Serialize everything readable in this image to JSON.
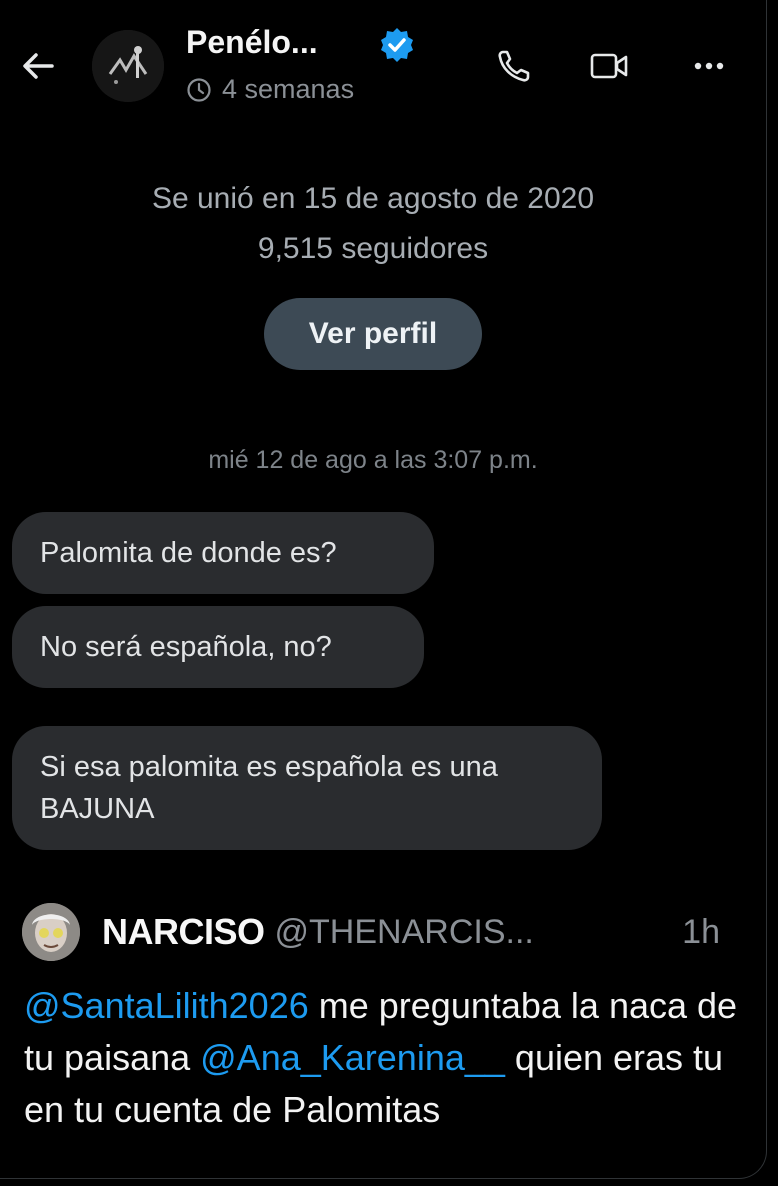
{
  "header": {
    "name": "Penélo...",
    "last_seen": "4 semanas"
  },
  "profile": {
    "joined": "Se unió en 15 de agosto de 2020",
    "followers": "9,515 seguidores",
    "view_profile_label": "Ver perfil"
  },
  "conversation": {
    "date": "mié 12 de ago a las 3:07 p.m.",
    "messages": [
      "Palomita de donde es?",
      "No será española, no?",
      "Si esa palomita es española es una BAJUNA"
    ]
  },
  "tweet": {
    "name": "NARCISO",
    "handle": "@THENARCIS...",
    "time": "1h",
    "mention1": "@SantaLilith2026",
    "text1": " me preguntaba la naca de tu paisana ",
    "mention2": "@Ana_Karenina__",
    "text2": " quien eras tu en tu cuenta de Palomitas"
  },
  "colors": {
    "background": "#000000",
    "bubble": "#2a2c2f",
    "accent_blue": "#1d9bf0",
    "profile_button": "#3d4a55"
  },
  "icons": [
    "back-arrow-icon",
    "verified-badge-icon",
    "clock-icon",
    "phone-icon",
    "video-camera-icon",
    "more-options-icon"
  ]
}
